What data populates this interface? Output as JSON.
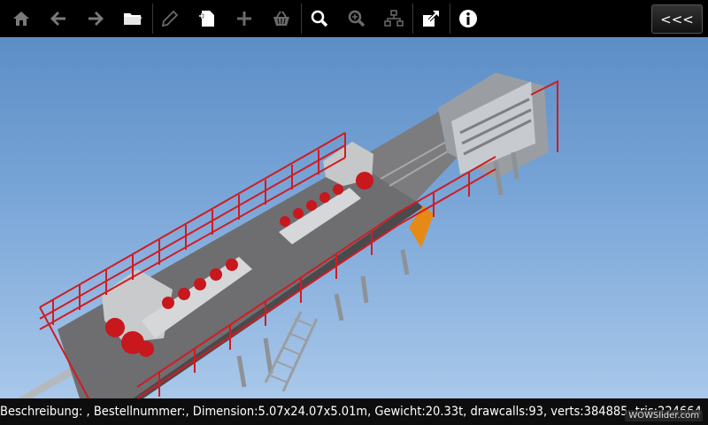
{
  "toolbar": {
    "buttons": [
      {
        "name": "home-button",
        "icon": "home-icon",
        "enabled": false
      },
      {
        "name": "back-button",
        "icon": "arrow-left-icon",
        "enabled": false
      },
      {
        "name": "forward-button",
        "icon": "arrow-right-icon",
        "enabled": false
      },
      {
        "name": "open-folder-button",
        "icon": "folder-icon",
        "enabled": true
      },
      {
        "name": "edit-button",
        "icon": "pencil-icon",
        "enabled": false
      },
      {
        "name": "new-document-button",
        "icon": "document-add-icon",
        "enabled": true
      },
      {
        "name": "add-button",
        "icon": "plus-icon",
        "enabled": false
      },
      {
        "name": "basket-button",
        "icon": "basket-icon",
        "enabled": false
      },
      {
        "name": "search-button",
        "icon": "search-icon",
        "enabled": true
      },
      {
        "name": "zoom-button",
        "icon": "zoom-icon",
        "enabled": false
      },
      {
        "name": "structure-button",
        "icon": "hierarchy-icon",
        "enabled": false
      },
      {
        "name": "share-button",
        "icon": "share-icon",
        "enabled": true
      },
      {
        "name": "info-button",
        "icon": "info-icon",
        "enabled": true
      }
    ],
    "collapse_label": "<<<"
  },
  "status": {
    "text": "Beschreibung: , Bestellnummer:, Dimension:5.07x24.07x5.01m, Gewicht:20.33t, drawcalls:93, verts:384885, tris:224664"
  },
  "watermark": "WOWSlider.com",
  "colors": {
    "sky_top": "#5c8ec6",
    "sky_bottom": "#a9c8ea",
    "railing": "#d01c22",
    "platform": "#6e6e6e",
    "motor": "#c8171d"
  }
}
